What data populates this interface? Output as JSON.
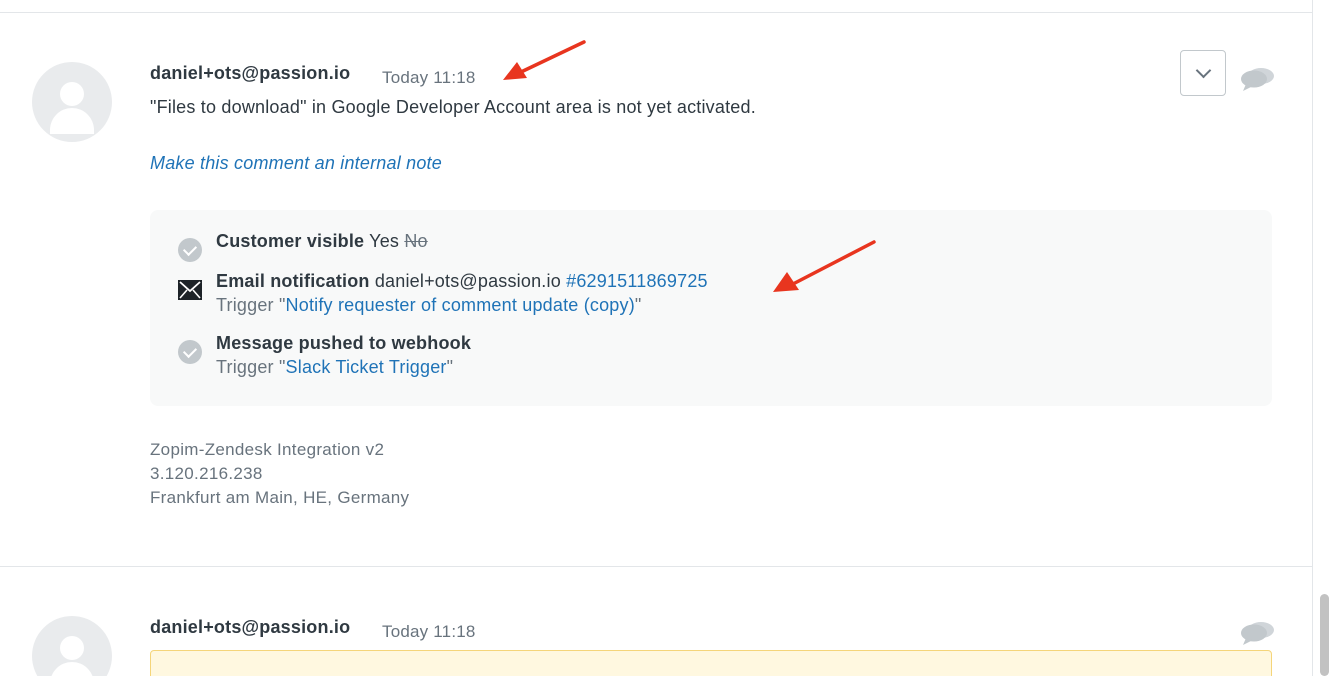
{
  "comments": [
    {
      "author": "daniel+ots@passion.io",
      "timestamp": "Today 11:18",
      "body": "\"Files to download\" in Google Developer Account area is not yet activated.",
      "make_internal_link": "Make this comment an internal note",
      "events": {
        "customer_visible": {
          "title": "Customer visible",
          "yes": "Yes",
          "no": "No"
        },
        "email_notification": {
          "title": "Email notification",
          "recipient": "daniel+ots@passion.io",
          "id_link": "#6291511869725",
          "trigger_prefix": "Trigger \"",
          "trigger_name": "Notify requester of comment update (copy)",
          "trigger_suffix": "\""
        },
        "webhook": {
          "title": "Message pushed to webhook",
          "trigger_prefix": "Trigger \"",
          "trigger_name": "Slack Ticket Trigger",
          "trigger_suffix": "\""
        }
      },
      "meta": {
        "via": "Zopim-Zendesk Integration v2",
        "ip": "3.120.216.238",
        "location": "Frankfurt am Main, HE, Germany"
      }
    },
    {
      "author": "daniel+ots@passion.io",
      "timestamp": "Today 11:18"
    }
  ],
  "icons": {
    "options": "chevron-down-icon",
    "reply": "speech-bubbles-icon",
    "check": "check-circle-icon",
    "email": "envelope-icon",
    "avatar": "user-avatar-icon",
    "annotation": "red-arrow-annotation"
  },
  "colors": {
    "link": "#1f73b7",
    "text": "#2f3941",
    "muted": "#68737d",
    "annotation": "#e8351f",
    "events_bg": "#f8f9f9",
    "warning_bg": "#fff8e0"
  }
}
